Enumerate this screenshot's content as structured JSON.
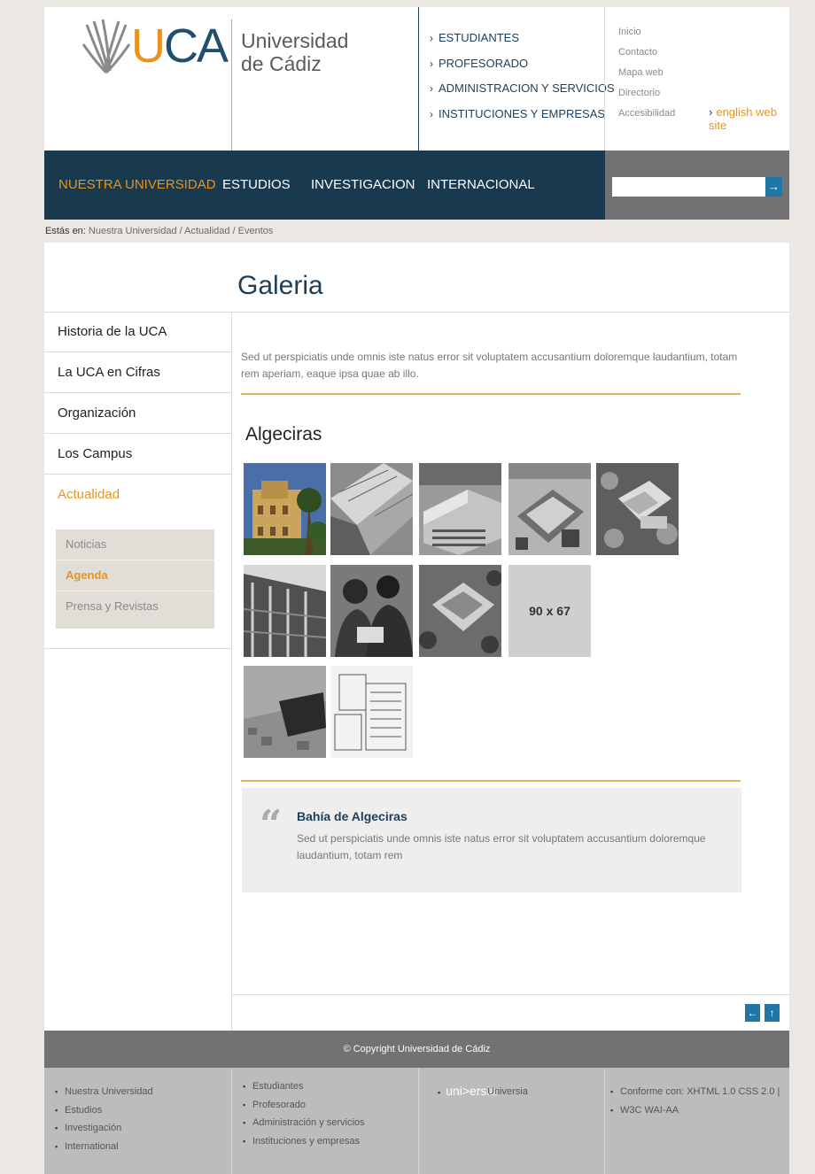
{
  "header": {
    "logo_text_u": "U",
    "logo_text_ca": "CA",
    "university_line1": "Universidad",
    "university_line2": "de Cádiz",
    "audience_links": [
      "ESTUDIANTES",
      "PROFESORADO",
      "ADMINISTRACION Y SERVICIOS",
      "INSTITUCIONES Y EMPRESAS"
    ],
    "utility_links": [
      "Inicio",
      "Contacto",
      "Mapa web",
      "Directorio",
      "Accesibilidad"
    ],
    "english_link": "english web site"
  },
  "nav": {
    "items": [
      "NUESTRA UNIVERSIDAD",
      "ESTUDIOS",
      "INVESTIGACION",
      "INTERNACIONAL"
    ],
    "active_index": 0,
    "search_placeholder": "",
    "search_button_icon": "→"
  },
  "breadcrumb": {
    "label": "Estás en:",
    "path": "Nuestra Universidad / Actualidad / Eventos"
  },
  "page_title": "Galeria",
  "sidebar": {
    "items": [
      "Historia de la UCA",
      "La UCA en Cifras",
      "Organización",
      "Los Campus",
      "Actualidad"
    ],
    "active_index": 4,
    "subitems": [
      "Noticias",
      "Agenda",
      "Prensa y Revistas"
    ],
    "active_subindex": 1
  },
  "main": {
    "intro": "Sed ut perspiciatis unde omnis iste natus error sit voluptatem accusantium doloremque laudantium, totam rem aperiam, eaque ipsa quae ab illo.",
    "gallery_title": "Algeciras",
    "placeholder_label": "90 x 67",
    "quote_icon": "“",
    "quote_title": "Bahía de Algeciras",
    "quote_text": "Sed ut perspiciatis unde omnis iste natus error sit voluptatem accusantium doloremque laudantium, totam rem"
  },
  "pager": {
    "prev_icon": "←",
    "top_icon": "↑"
  },
  "footer": {
    "copyright": "© Copyright Universidad de Cádiz",
    "col1": [
      "Nuestra Universidad",
      "Estudios",
      "Investigación",
      "International"
    ],
    "col2": [
      "Estudiantes",
      "Profesorado",
      "Administración y servicios",
      "Instituciones y empresas"
    ],
    "universia_logo": "uni>ersia",
    "universia_label": "Universia",
    "col4": [
      "Conforme con: XHTML 1.0  CSS 2.0 |",
      "W3C WAI-AA"
    ]
  },
  "colors": {
    "accent": "#e8941f",
    "navy": "#18394e",
    "blue": "#1f77a6",
    "gray": "#727275"
  }
}
